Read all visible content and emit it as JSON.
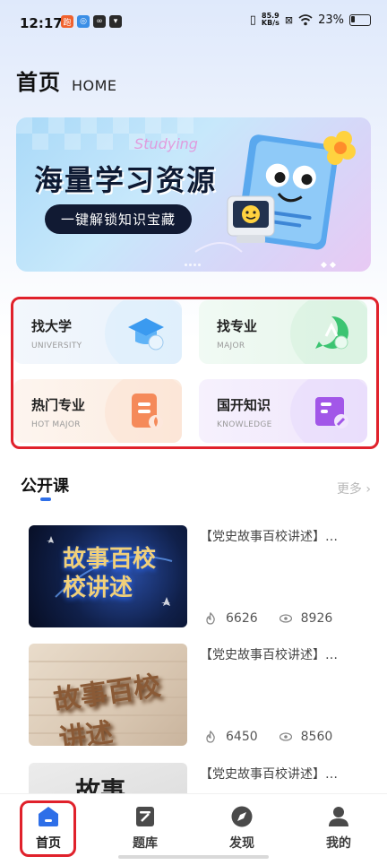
{
  "status_bar": {
    "time": "12:17",
    "net_speed_value": "85.9",
    "net_speed_unit": "KB/s",
    "battery": "23%"
  },
  "header": {
    "title": "首页",
    "subtitle": "HOME"
  },
  "banner": {
    "title": "海量学习资源",
    "cta": "一键解锁知识宝藏",
    "script_text": "Studying"
  },
  "categories": [
    {
      "title": "找大学",
      "sub": "UNIVERSITY",
      "icon": "graduation-cap-icon"
    },
    {
      "title": "找专业",
      "sub": "MAJOR",
      "icon": "bicycle-icon"
    },
    {
      "title": "热门专业",
      "sub": "HOT MAJOR",
      "icon": "fire-doc-icon"
    },
    {
      "title": "国开知识",
      "sub": "KNOWLEDGE",
      "icon": "book-pen-icon"
    }
  ],
  "section": {
    "title": "公开课",
    "more": "更多"
  },
  "courses": [
    {
      "title": "【党史故事百校讲述】…",
      "likes": "6626",
      "views": "8926",
      "thumb_text": "故事百校 校讲述"
    },
    {
      "title": "【党史故事百校讲述】…",
      "likes": "6450",
      "views": "8560",
      "thumb_text": "故事百校讲述"
    },
    {
      "title": "【党史故事百校讲述】…",
      "thumb_text": "故事"
    }
  ],
  "bottom_nav": [
    {
      "label": "首页",
      "icon": "home-icon",
      "active": true
    },
    {
      "label": "题库",
      "icon": "question-bank-icon"
    },
    {
      "label": "发现",
      "icon": "compass-icon"
    },
    {
      "label": "我的",
      "icon": "profile-icon"
    }
  ],
  "colors": {
    "accent": "#2e6fe8",
    "highlight": "#e0212b",
    "banner_dark": "#111a33"
  }
}
